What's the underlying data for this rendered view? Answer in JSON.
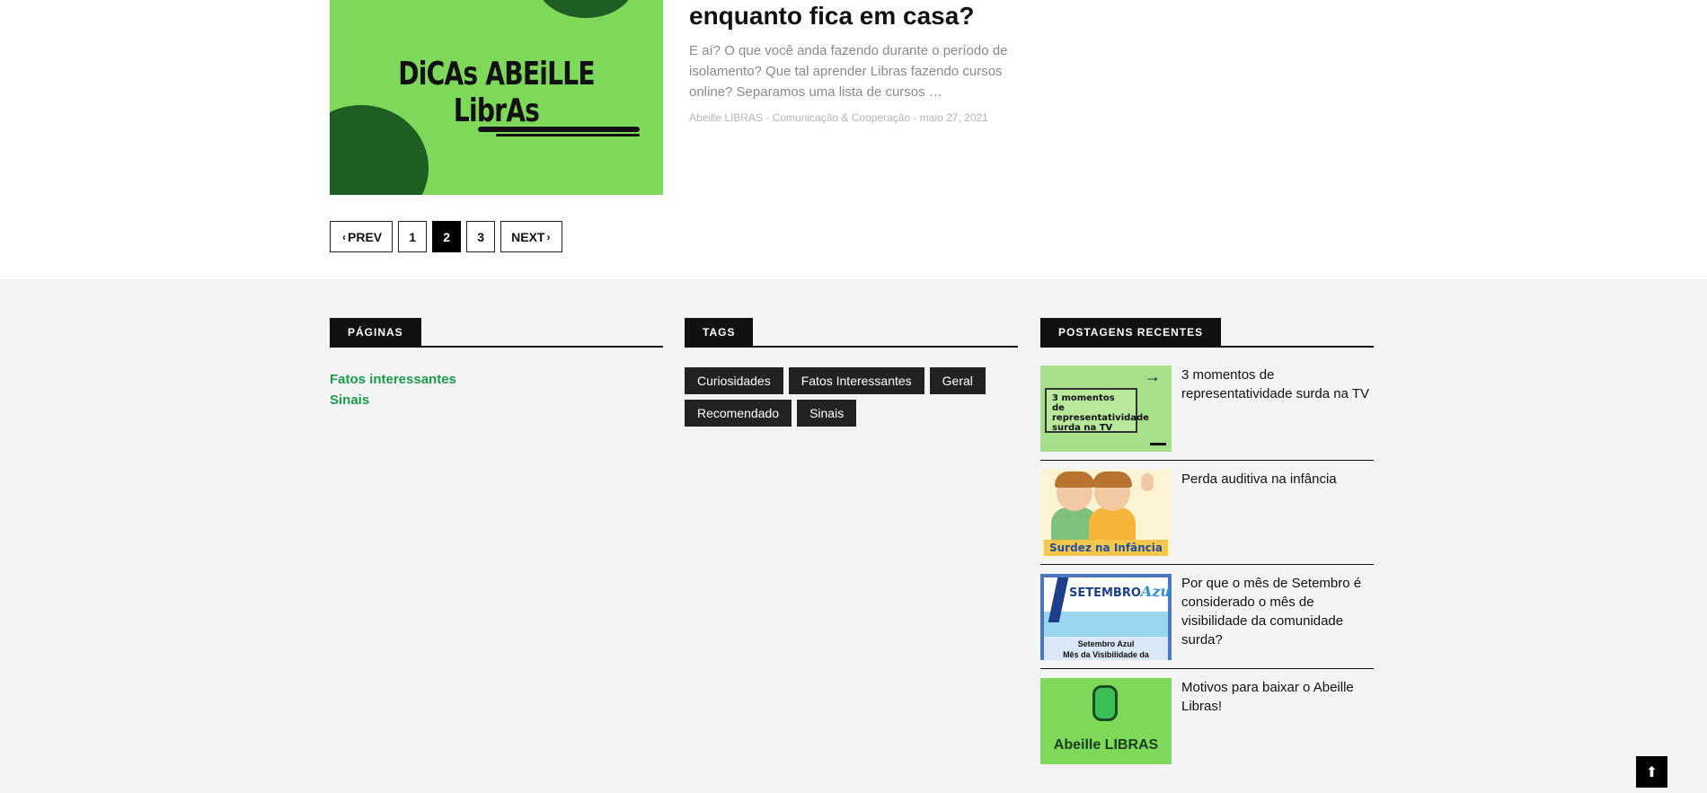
{
  "article": {
    "title": "enquanto fica em casa?",
    "thumb_text": "DiCAs ABEiLLE LibrAs",
    "excerpt": "E aí? O que você anda fazendo durante o período de isolamento? Que tal aprender Libras fazendo cursos online? Separamos uma lista de cursos …",
    "meta": "Abeille LIBRAS - Comunicação & Cooperação - maio 27, 2021"
  },
  "pager": {
    "prev": "PREV",
    "next": "NEXT",
    "pages": [
      "1",
      "2",
      "3"
    ],
    "current": "2"
  },
  "footer": {
    "pages_widget": {
      "title": "PÁGINAS",
      "links": [
        "Fatos interessantes",
        "Sinais"
      ],
      "link_color": "#1a9b4a"
    },
    "tags_widget": {
      "title": "TAGS",
      "tags": [
        "Curiosidades",
        "Fatos Interessantes",
        "Geral",
        "Recomendado",
        "Sinais"
      ]
    },
    "recent_widget": {
      "title": "POSTAGENS RECENTES",
      "posts": [
        {
          "title": "3 momentos de representatividade surda na TV",
          "thumb_text": "3 momentos de representatividade surda na TV"
        },
        {
          "title": "Perda auditiva na infância",
          "thumb_text": "Surdez na Infância"
        },
        {
          "title": "Por que o mês de Setembro é considerado o mês de visibilidade da comunidade surda?",
          "thumb_head": "SETEMBRO",
          "thumb_head_accent": "Azul",
          "thumb_caption_1": "Setembro Azul",
          "thumb_caption_2": "Mês da Visibilidade da"
        },
        {
          "title": "Motivos para baixar o Abeille Libras!",
          "thumb_text": "Abeille LIBRAS"
        }
      ]
    }
  },
  "back_to_top": {
    "icon": "arrow-up-icon"
  }
}
